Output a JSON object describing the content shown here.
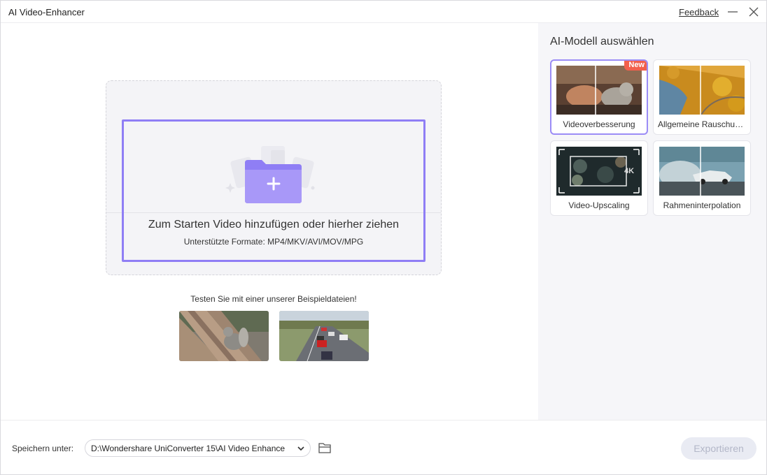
{
  "window": {
    "title": "AI Video-Enhancer",
    "feedback_label": "Feedback"
  },
  "dropzone": {
    "main_text": "Zum Starten Video hinzufügen oder hierher ziehen",
    "formats_text": "Unterstützte Formate: MP4/MKV/AVI/MOV/MPG"
  },
  "samples": {
    "prompt": "Testen Sie mit einer unserer Beispieldateien!",
    "items": [
      "squirrel-bench-sample",
      "highway-traffic-sample"
    ]
  },
  "models": {
    "title": "AI-Modell auswählen",
    "items": [
      {
        "label": "Videoverbesserung",
        "badge": "New",
        "selected": true
      },
      {
        "label": "Allgemeine Rauschunterdrückung",
        "selected": false
      },
      {
        "label": "Video-Upscaling",
        "overlay": "4K",
        "selected": false
      },
      {
        "label": "Rahmeninterpolation",
        "selected": false
      }
    ]
  },
  "footer": {
    "save_label": "Speichern unter:",
    "save_path": "D:\\Wondershare UniConverter 15\\AI Video Enhance",
    "export_label": "Exportieren"
  },
  "colors": {
    "accent": "#8f7ef5",
    "badge": "#f25f4c",
    "export_disabled_bg": "#e9ebf3",
    "export_disabled_text": "#b3b7c8"
  }
}
